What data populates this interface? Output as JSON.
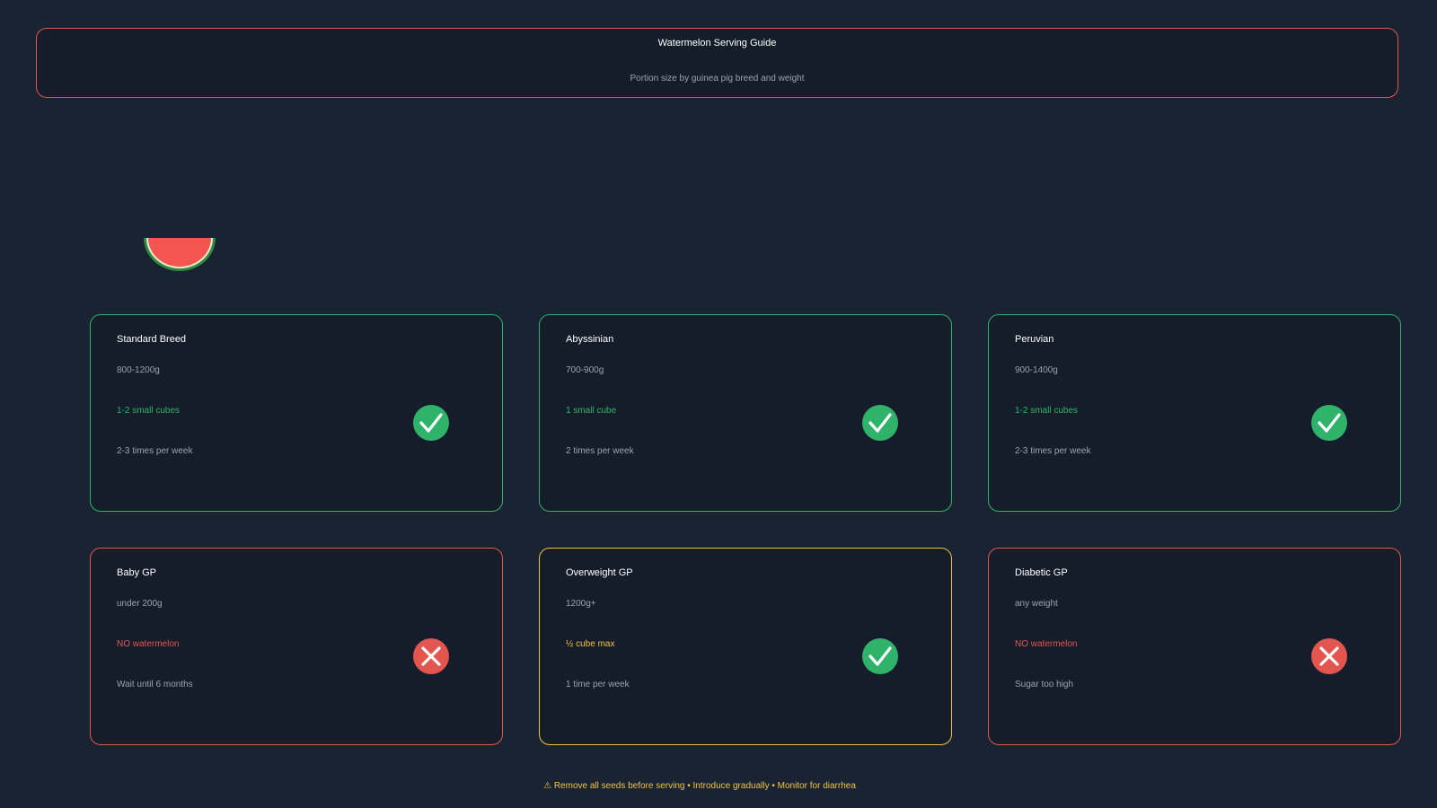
{
  "header": {
    "title": "Watermelon Serving Guide",
    "subtitle": "Portion size by guinea pig breed and weight"
  },
  "colors": {
    "background": "#1a2332",
    "ok": "#2fb36a",
    "no": "#e3554f",
    "caution": "#f2c53d"
  },
  "cards": [
    {
      "name": "Standard Breed",
      "weight": "800-1200g",
      "portion": "1-2 small cubes",
      "frequency": "2-3 times per week",
      "status": "check-icon"
    },
    {
      "name": "Abyssinian",
      "weight": "700-900g",
      "portion": "1 small cube",
      "frequency": "2 times per week",
      "status": "check-icon"
    },
    {
      "name": "Peruvian",
      "weight": "900-1400g",
      "portion": "1-2 small cubes",
      "frequency": "2-3 times per week",
      "status": "check-icon"
    },
    {
      "name": "Baby GP",
      "weight": "under 200g",
      "portion": "NO watermelon",
      "frequency": "Wait until 6 months",
      "status": "cross-icon"
    },
    {
      "name": "Overweight GP",
      "weight": "1200g+",
      "portion": "½ cube max",
      "frequency": "1 time per week",
      "status": "check-icon"
    },
    {
      "name": "Diabetic GP",
      "weight": "any weight",
      "portion": "NO watermelon",
      "frequency": "Sugar too high",
      "status": "cross-icon"
    }
  ],
  "footer": {
    "note": "⚠ Remove all seeds before serving • Introduce gradually • Monitor for diarrhea"
  }
}
